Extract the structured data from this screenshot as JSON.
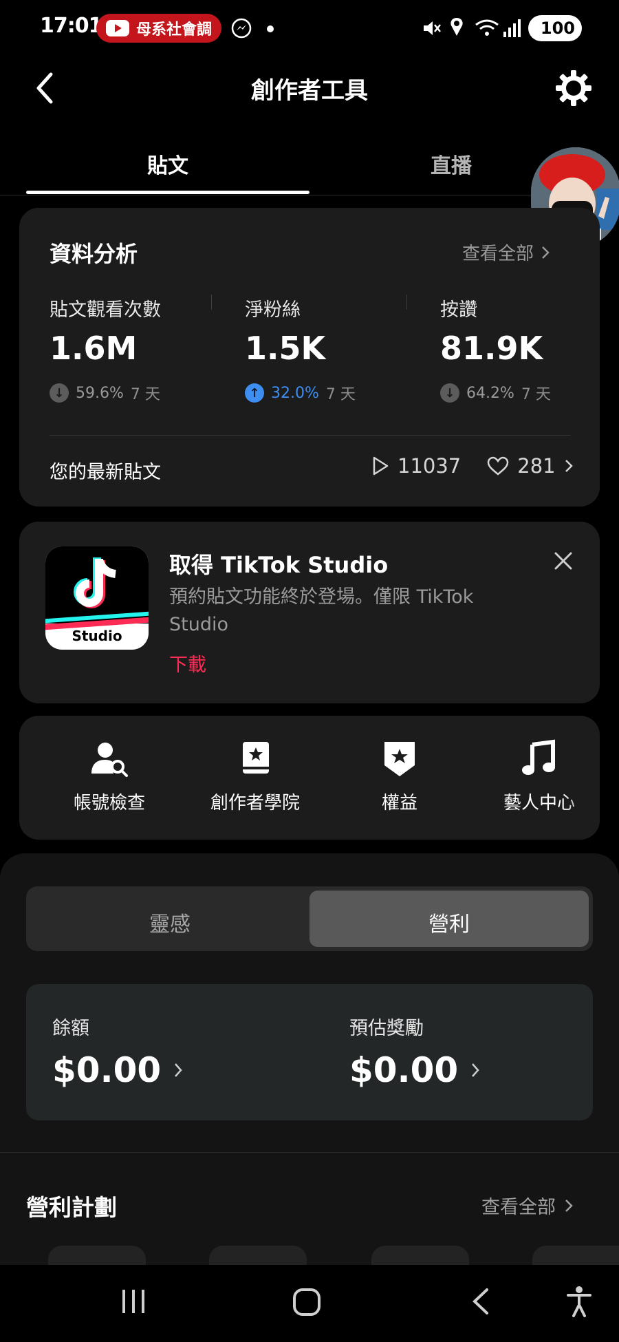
{
  "status_bar": {
    "time": "17:01",
    "notification_pill_text": "母系社會調",
    "battery": "100"
  },
  "header": {
    "title": "創作者工具"
  },
  "tabs": [
    {
      "label": "貼文"
    },
    {
      "label": "直播"
    }
  ],
  "analytics": {
    "title": "資料分析",
    "view_all": "查看全部",
    "metrics": [
      {
        "label": "貼文觀看次數",
        "value": "1.6M",
        "change": "59.6%",
        "direction": "down",
        "period": "7 天"
      },
      {
        "label": "淨粉絲",
        "value": "1.5K",
        "change": "32.0%",
        "direction": "up",
        "period": "7 天"
      },
      {
        "label": "按讚",
        "value": "81.9K",
        "change": "64.2%",
        "direction": "down",
        "period": "7 天"
      }
    ],
    "latest_post_label": "您的最新貼文",
    "latest_post_views": "11037",
    "latest_post_likes": "281"
  },
  "promo": {
    "title": "取得 TikTok Studio",
    "description": "預約貼文功能終於登場。僅限 TikTok Studio",
    "action": "下載",
    "app_icon_label": "Studio"
  },
  "tools": [
    {
      "label": "帳號檢查",
      "icon": "account-check-icon"
    },
    {
      "label": "創作者學院",
      "icon": "academy-book-icon"
    },
    {
      "label": "權益",
      "icon": "benefits-badge-icon"
    },
    {
      "label": "藝人中心",
      "icon": "music-note-icon"
    }
  ],
  "segment": {
    "options": [
      "靈感",
      "營利"
    ],
    "selected": "營利"
  },
  "earnings": {
    "balance_label": "餘額",
    "balance_value": "$0.00",
    "estimated_label": "預估獎勵",
    "estimated_value": "$0.00"
  },
  "monetization": {
    "title": "營利計劃",
    "view_all": "查看全部"
  },
  "colors": {
    "background": "#000000",
    "card": "#1c1c1c",
    "accent_up": "#3d8ef0",
    "accent_red": "#fe2c55"
  }
}
